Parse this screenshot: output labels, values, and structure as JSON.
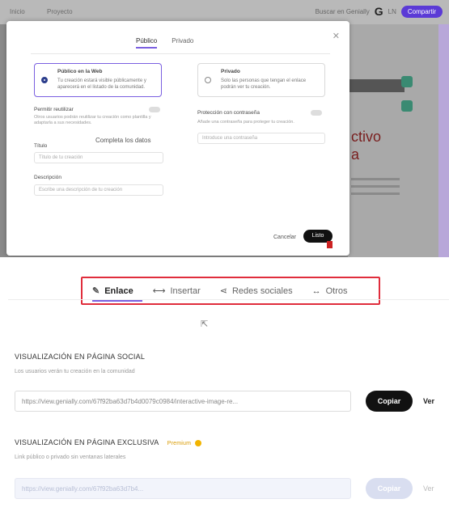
{
  "app_bar": {
    "crumb1": "Inicio",
    "crumb2": "Proyecto",
    "search": "Buscar en Genially",
    "logo": "G",
    "user": "LN",
    "share_label": "Compartir"
  },
  "modal": {
    "tabs": [
      "Público",
      "Privado"
    ],
    "options": [
      {
        "title": "Público en la Web",
        "text": "Tu creación estará visible públicamente y aparecerá en el listado de la comunidad."
      },
      {
        "title": "Privado",
        "text": "Solo las personas que tengan el enlace podrán ver tu creación."
      }
    ],
    "labels": {
      "reuse": "Permitir reutilizar",
      "reuse_hint": "Otros usuarios podrán reutilizar tu creación como plantilla y adaptarla a sus necesidades.",
      "title": "Título",
      "title_placeholder": "Título de tu creación",
      "description": "Descripción",
      "description_placeholder": "Escribe una descripción de tu creación",
      "protect": "Protección con contraseña",
      "protect_hint": "Añade una contraseña para proteger tu creación.",
      "password_placeholder": "Introduce una contraseña"
    },
    "complete_data": "Completa los datos",
    "cancel": "Cancelar",
    "save": "Listo"
  },
  "share_tabs": [
    {
      "icon": "✎",
      "label": "Enlace",
      "active": true
    },
    {
      "icon": "⟷",
      "label": "Insertar",
      "active": false
    },
    {
      "icon": "⋖",
      "label": "Redes sociales",
      "active": false
    },
    {
      "icon": "↔",
      "label": "Otros",
      "active": false
    }
  ],
  "social_section": {
    "title": "VISUALIZACIÓN EN PÁGINA SOCIAL",
    "subtitle": "Los usuarios verán tu creación en la comunidad",
    "url": "https://view.genially.com/67f92ba63d7b4d0079c0984/interactive-image-re...",
    "copy_label": "Copiar",
    "see_label": "Ver"
  },
  "exclusive_section": {
    "title": "VISUALIZACIÓN EN PÁGINA EXCLUSIVA",
    "badge": "Premium",
    "subtitle": "Link público o privado sin ventanas laterales",
    "url": "https://view.genially.com/67f92ba63d7b4...",
    "copy_label": "Copiar",
    "see_label": "Ver"
  },
  "colors": {
    "accent": "#7a5fe0",
    "highlight_border": "#e02d3c",
    "primary_button": "#111111",
    "premium": "#f2b400"
  }
}
